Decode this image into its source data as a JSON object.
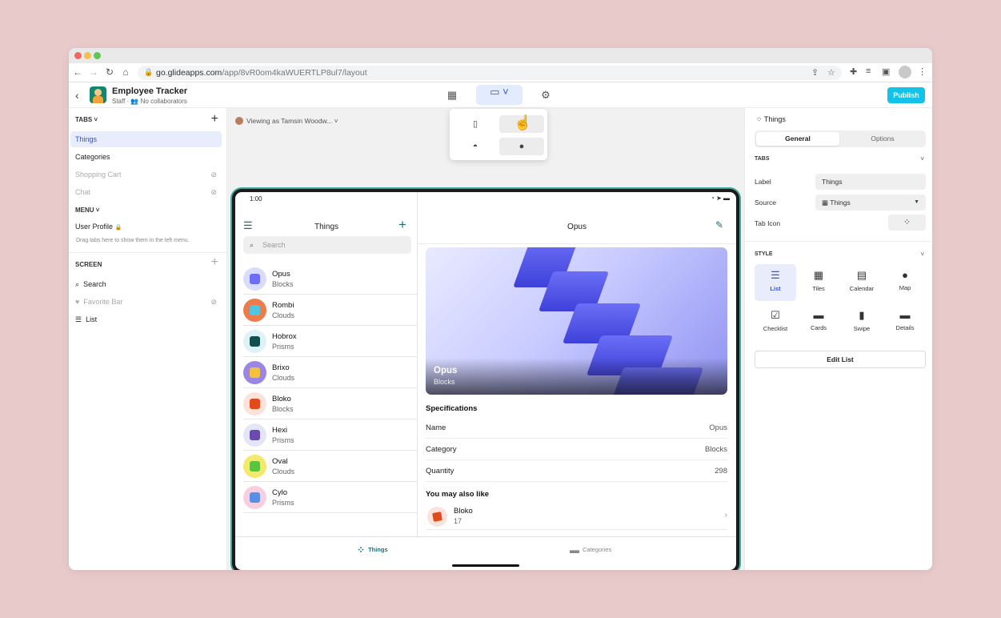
{
  "browser": {
    "url_host": "go.glideapps.com",
    "url_path": "/app/8vR0om4kaWUERTLP8ul7/layout"
  },
  "header": {
    "app_title": "Employee Tracker",
    "app_role": "Staff",
    "collaborators": "No collaborators",
    "publish_label": "Publish"
  },
  "left": {
    "tabs_heading": "TABS",
    "tabs": [
      {
        "label": "Things",
        "state": "selected"
      },
      {
        "label": "Categories",
        "state": "normal"
      },
      {
        "label": "Shopping Cart",
        "state": "hidden"
      },
      {
        "label": "Chat",
        "state": "hidden"
      }
    ],
    "menu_heading": "MENU",
    "menu_items": [
      {
        "label": "User Profile"
      }
    ],
    "menu_hint": "Drag tabs here to show them in the left menu.",
    "screen_heading": "SCREEN",
    "screen_items": [
      {
        "label": "Search",
        "icon": "search-icon"
      },
      {
        "label": "Favorite Bar",
        "icon": "heart-icon"
      },
      {
        "label": "List",
        "icon": "list-icon"
      }
    ]
  },
  "canvas": {
    "viewing_prefix": "Viewing as",
    "viewing_name": "Tamsin Woodw..."
  },
  "device": {
    "time": "1:00",
    "list_title": "Things",
    "search_placeholder": "Search",
    "items": [
      {
        "name": "Opus",
        "category": "Blocks",
        "color": "#d9dcfb",
        "accent": "#6b6ef5"
      },
      {
        "name": "Rombi",
        "category": "Clouds",
        "color": "#f07b4a",
        "accent": "#4fc6e3"
      },
      {
        "name": "Hobrox",
        "category": "Prisms",
        "color": "#dff3f7",
        "accent": "#12514f"
      },
      {
        "name": "Brixo",
        "category": "Clouds",
        "color": "#9b86e6",
        "accent": "#f3c23a"
      },
      {
        "name": "Bloko",
        "category": "Blocks",
        "color": "#fbe3dc",
        "accent": "#e2491b"
      },
      {
        "name": "Hexi",
        "category": "Prisms",
        "color": "#e4e6f8",
        "accent": "#6a4bb0"
      },
      {
        "name": "Oval",
        "category": "Clouds",
        "color": "#f6e86c",
        "accent": "#5ac43c"
      },
      {
        "name": "Cylo",
        "category": "Prisms",
        "color": "#f7cfe1",
        "accent": "#5a8fe6"
      }
    ],
    "detail_title": "Opus",
    "hero_name": "Opus",
    "hero_category": "Blocks",
    "spec_title": "Specifications",
    "specs": [
      {
        "key": "Name",
        "value": "Opus"
      },
      {
        "key": "Category",
        "value": "Blocks"
      },
      {
        "key": "Quantity",
        "value": "298"
      }
    ],
    "also_title": "You may also like",
    "also_item": {
      "name": "Bloko",
      "sub": "17"
    },
    "tabbar": [
      {
        "label": "Things",
        "active": true
      },
      {
        "label": "Categories",
        "active": false
      }
    ]
  },
  "right": {
    "component_title": "Things",
    "seg_general": "General",
    "seg_options": "Options",
    "tabs_heading": "TABS",
    "label_label": "Label",
    "label_value": "Things",
    "source_label": "Source",
    "source_value": "Things",
    "tab_icon_label": "Tab Icon",
    "style_heading": "STYLE",
    "styles": [
      {
        "label": "List",
        "icon": "list-style-icon",
        "active": true
      },
      {
        "label": "Tiles",
        "icon": "tiles-icon",
        "active": false
      },
      {
        "label": "Calendar",
        "icon": "calendar-icon",
        "active": false
      },
      {
        "label": "Map",
        "icon": "map-pin-icon",
        "active": false
      },
      {
        "label": "Checklist",
        "icon": "checklist-icon",
        "active": false
      },
      {
        "label": "Cards",
        "icon": "cards-icon",
        "active": false
      },
      {
        "label": "Swipe",
        "icon": "swipe-icon",
        "active": false
      },
      {
        "label": "Details",
        "icon": "details-icon",
        "active": false
      }
    ],
    "edit_list_label": "Edit List"
  },
  "colors": {
    "accent_teal": "#1a6f74",
    "publish_cyan": "#12c2e8",
    "selection_blue": "#3a4fc8",
    "page_background": "#e8cacb"
  }
}
